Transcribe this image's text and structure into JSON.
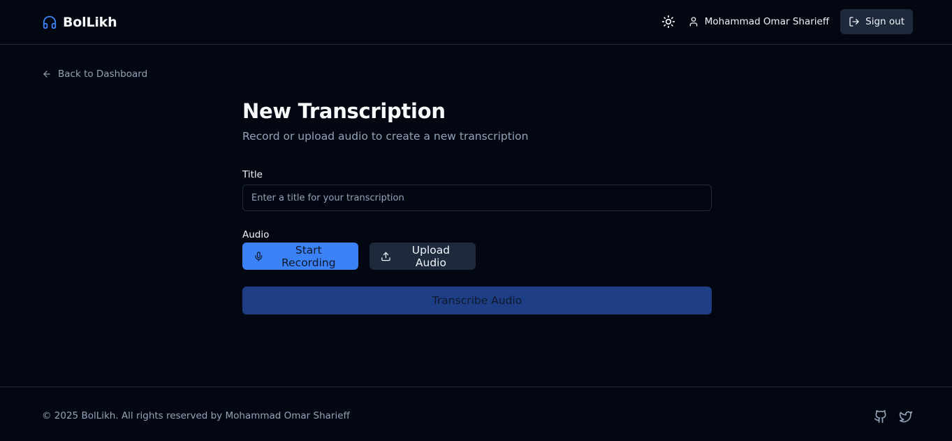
{
  "header": {
    "app_name": "BolLikh",
    "logo_icon": "headphones-icon",
    "theme_toggle_icon": "sun-icon",
    "user_icon": "user-icon",
    "user_name": "Mohammad Omar Sharieff",
    "signout_icon": "log-out-icon",
    "signout_label": "Sign out"
  },
  "nav": {
    "back_icon": "arrow-left-icon",
    "back_label": "Back to Dashboard"
  },
  "main": {
    "title": "New Transcription",
    "subtitle": "Record or upload audio to create a new transcription",
    "title_field": {
      "label": "Title",
      "placeholder": "Enter a title for your transcription",
      "value": ""
    },
    "audio_field": {
      "label": "Audio",
      "record_icon": "microphone-icon",
      "record_label": "Start Recording",
      "upload_icon": "upload-icon",
      "upload_label": "Upload Audio"
    },
    "transcribe_label": "Transcribe Audio"
  },
  "footer": {
    "copyright": "© 2025 BolLikh. All rights reserved by Mohammad Omar Sharieff",
    "links": [
      "github-icon",
      "twitter-icon"
    ]
  },
  "colors": {
    "background": "#030712",
    "border": "#1e293b",
    "accent": "#3b82f6",
    "accent_disabled": "#1e3f86",
    "muted_text": "#94a3b8"
  }
}
